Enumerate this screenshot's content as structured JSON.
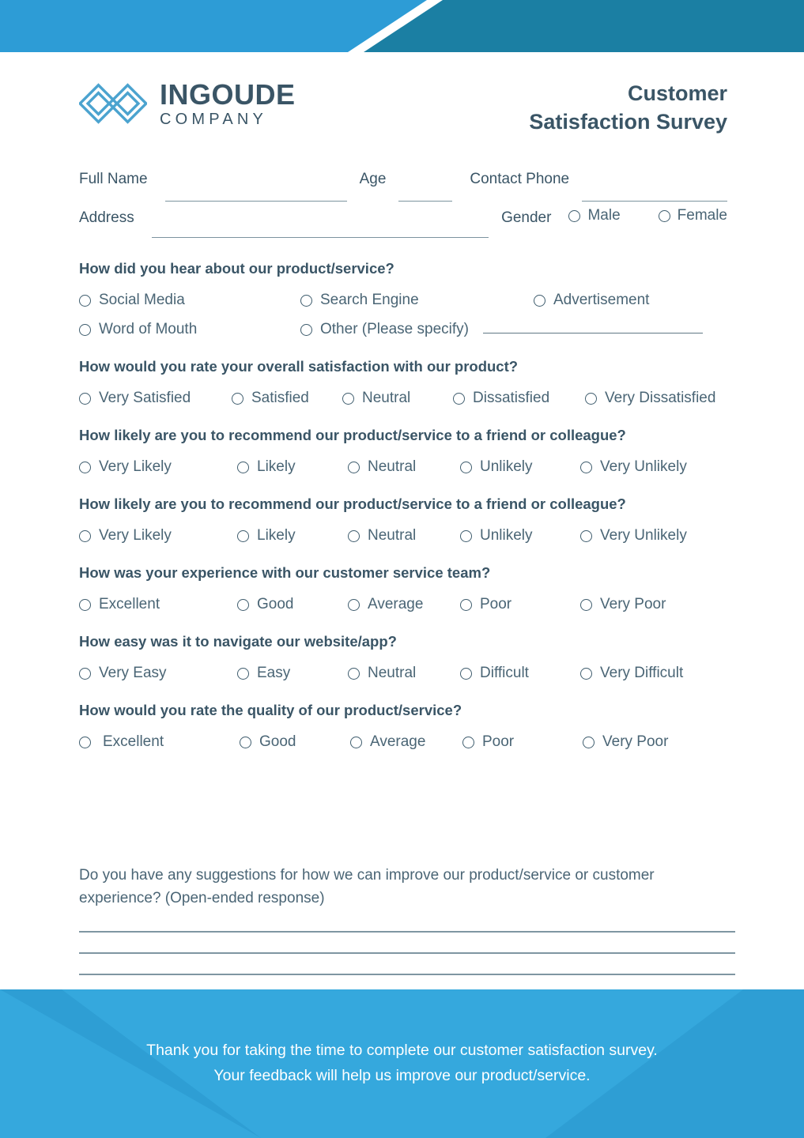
{
  "theme": {
    "banner_light_blue": "#2d9cd6",
    "banner_dark_blue": "#1b7fa3",
    "footer_blue": "#35a8dd",
    "heading_slate": "#3a5566",
    "label_slate": "#4a6575",
    "rule_gray": "#7c939f"
  },
  "brand": {
    "name": "INGOUDE",
    "subtitle": "COMPANY"
  },
  "document": {
    "title_line1": "Customer",
    "title_line2": "Satisfaction Survey"
  },
  "fields": {
    "full_name": "Full Name",
    "age": "Age",
    "contact_phone": "Contact Phone",
    "address": "Address",
    "gender": "Gender",
    "gender_options": [
      "Male",
      "Female"
    ]
  },
  "questions": [
    {
      "title": "How did you hear about our product/service?",
      "rows": [
        [
          "Social Media",
          "Search Engine",
          "Advertisement"
        ],
        [
          "Word of Mouth",
          "Other (Please specify)"
        ]
      ],
      "has_specify_line": true
    },
    {
      "title": "How would you rate your overall satisfaction with our product?",
      "options": [
        "Very Satisfied",
        "Satisfied",
        "Neutral",
        "Dissatisfied",
        "Very Dissatisfied"
      ]
    },
    {
      "title": "How likely are you to recommend our product/service to a friend or colleague?",
      "options": [
        "Very Likely",
        "Likely",
        "Neutral",
        "Unlikely",
        "Very Unlikely"
      ]
    },
    {
      "title": "How likely are you to recommend our product/service to a friend or colleague?",
      "options": [
        "Very Likely",
        "Likely",
        "Neutral",
        "Unlikely",
        "Very Unlikely"
      ]
    },
    {
      "title": "How was your experience with our customer service team?",
      "options": [
        "Excellent",
        "Good",
        "Average",
        "Poor",
        "Very Poor"
      ]
    },
    {
      "title": "How easy was it to navigate our website/app?",
      "options": [
        "Very Easy",
        "Easy",
        "Neutral",
        "Difficult",
        "Very Difficult"
      ]
    },
    {
      "title": "How would you rate the quality of our product/service?",
      "options": [
        "Excellent",
        "Good",
        "Average",
        "Poor",
        "Very Poor"
      ]
    }
  ],
  "open_ended": {
    "prompt": "Do you have any suggestions for how we can improve our product/service or customer experience? (Open-ended response)",
    "line_count": 3
  },
  "footer": {
    "line1": "Thank you for taking the time to complete our customer satisfaction survey.",
    "line2": "Your feedback will help us improve our product/service."
  }
}
